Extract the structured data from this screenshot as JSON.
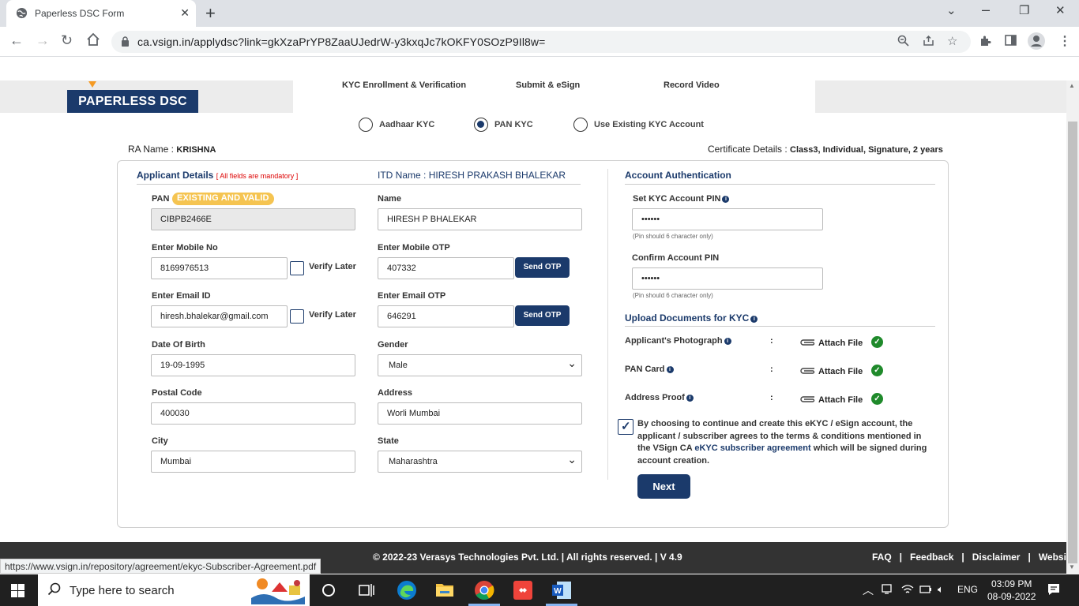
{
  "browser": {
    "tab_title": "Paperless DSC Form",
    "url": "ca.vsign.in/applydsc?link=gkXzaPrYP8ZaaUJedrW-y3kxqJc7kOKFY0SOzP9Il8w=",
    "status_url": "https://www.vsign.in/repository/agreement/ekyc-Subscriber-Agreement.pdf"
  },
  "header": {
    "logo_text": "PAPERLESS DSC",
    "steps": [
      "KYC Enrollment & Verification",
      "Submit & eSign",
      "Record Video"
    ]
  },
  "kyc_options": [
    {
      "label": "Aadhaar KYC",
      "selected": false
    },
    {
      "label": "PAN KYC",
      "selected": true
    },
    {
      "label": "Use Existing KYC Account",
      "selected": false
    }
  ],
  "meta": {
    "ra_label": "RA Name :",
    "ra_value": "KRISHNA",
    "cert_label": "Certificate Details :",
    "cert_value": "Class3, Individual, Signature, 2 years"
  },
  "applicant": {
    "title": "Applicant Details",
    "mandatory_note": "[ All fields are mandatory ]",
    "itd_label": "ITD Name :",
    "itd_value": "HIRESH PRAKASH BHALEKAR",
    "pan_label": "PAN",
    "pan_badge": "EXISTING AND VALID",
    "pan_value": "CIBPB2466E",
    "name_label": "Name",
    "name_value": "HIRESH P BHALEKAR",
    "mobile_label": "Enter Mobile No",
    "mobile_value": "8169976513",
    "verify_later": "Verify Later",
    "mobile_otp_label": "Enter Mobile OTP",
    "mobile_otp_value": "407332",
    "send_otp": "Send OTP",
    "email_label": "Enter Email ID",
    "email_value": "hiresh.bhalekar@gmail.com",
    "email_otp_label": "Enter Email OTP",
    "email_otp_value": "646291",
    "dob_label": "Date Of Birth",
    "dob_value": "19-09-1995",
    "gender_label": "Gender",
    "gender_value": "Male",
    "postal_label": "Postal Code",
    "postal_value": "400030",
    "address_label": "Address",
    "address_value": "Worli Mumbai",
    "city_label": "City",
    "city_value": "Mumbai",
    "state_label": "State",
    "state_value": "Maharashtra"
  },
  "account": {
    "title": "Account Authentication",
    "pin_label": "Set KYC Account PIN",
    "pin_value": "••••••",
    "pin_hint": "(Pin should 6 character only)",
    "confirm_label": "Confirm Account PIN",
    "confirm_value": "••••••",
    "confirm_hint": "(Pin should 6 character only)"
  },
  "uploads": {
    "title": "Upload Documents for KYC",
    "colon": ":",
    "attach_label": "Attach File",
    "items": [
      "Applicant's Photograph",
      "PAN Card",
      "Address Proof"
    ]
  },
  "agreement": {
    "text_before": "By choosing to continue and create this eKYC / eSign account, the applicant / subscriber agrees to the terms & conditions mentioned in the VSign CA ",
    "link_text": "eKYC subscriber agreement",
    "text_after": " which will be signed during account creation."
  },
  "next_label": "Next",
  "footer": {
    "copyright": "© 2022-23 Verasys Technologies Pvt. Ltd. | All rights reserved. | V 4.9",
    "links": [
      "FAQ",
      "Feedback",
      "Disclaimer",
      "Website"
    ],
    "separator": "|"
  },
  "taskbar": {
    "search_placeholder": "Type here to search",
    "language": "ENG",
    "time": "03:09 PM",
    "date": "08-09-2022"
  },
  "colors": {
    "brand_navy": "#1b3a6b",
    "badge_yellow": "#f5c451",
    "success_green": "#1f8a2b",
    "logo_accent": "#f59a23"
  }
}
